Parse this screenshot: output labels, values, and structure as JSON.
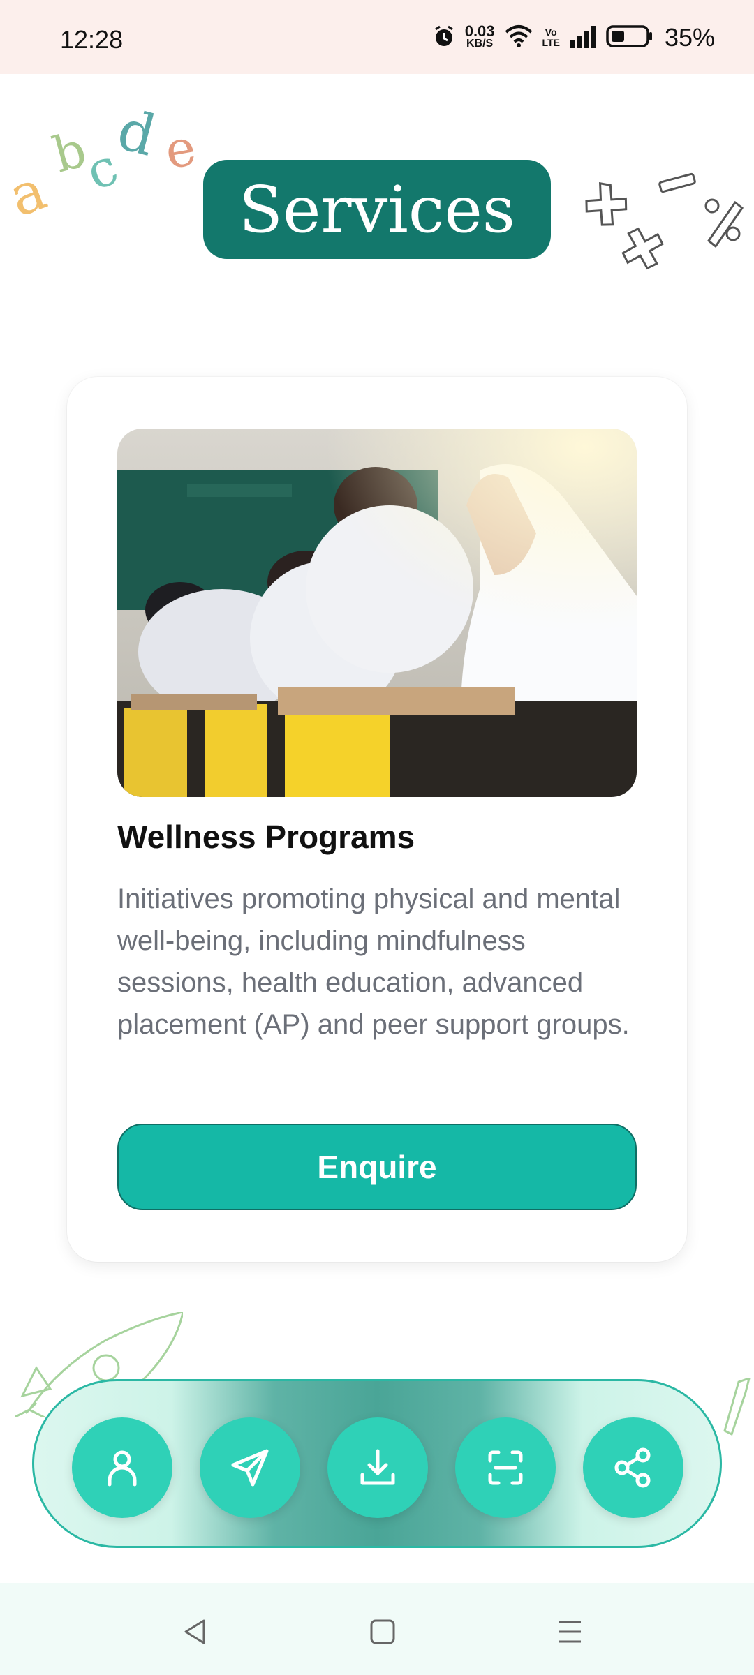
{
  "status_bar": {
    "time": "12:28",
    "net_speed_value": "0.03",
    "net_speed_unit": "KB/S",
    "volte_top": "Vo",
    "volte_bottom": "LTE",
    "battery_percent": "35%",
    "icons": [
      "alarm-icon",
      "wifi-icon",
      "volte-icon",
      "signal-icon",
      "battery-icon"
    ]
  },
  "header": {
    "title": "Services",
    "title_bg": "#13786c"
  },
  "card": {
    "image_alt": "Students writing at desks in a classroom",
    "title": "Wellness Programs",
    "description": "Initiatives promoting physical and mental well-being, including mindfulness sessions, health education, advanced placement (AP) and peer support groups.",
    "button_label": "Enquire",
    "button_color": "#15b8a6"
  },
  "action_bar": {
    "buttons": [
      {
        "icon": "profile-icon"
      },
      {
        "icon": "send-icon"
      },
      {
        "icon": "download-icon"
      },
      {
        "icon": "scan-icon"
      },
      {
        "icon": "share-icon"
      }
    ],
    "accent": "#2fd1b7"
  },
  "system_nav": {
    "buttons": [
      "back-icon",
      "home-icon",
      "menu-icon"
    ]
  }
}
